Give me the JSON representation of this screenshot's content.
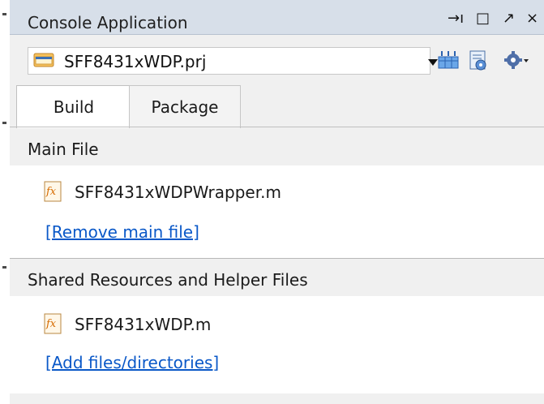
{
  "panel": {
    "title": "Console Application",
    "window_controls": {
      "pin": "→ı",
      "maximize": "□",
      "undock": "↗",
      "close": "×"
    }
  },
  "project": {
    "file_name": "SFF8431xWDP.prj",
    "icons": [
      "project-file-icon",
      "package-icon",
      "build-icon",
      "settings-gear-icon"
    ]
  },
  "tabs": [
    {
      "label": "Build",
      "active": true
    },
    {
      "label": "Package",
      "active": false
    }
  ],
  "main_file": {
    "heading": "Main File",
    "file": "SFF8431xWDPWrapper.m",
    "action_link": "[Remove main file]"
  },
  "shared": {
    "heading": "Shared Resources and Helper Files",
    "file": "SFF8431xWDP.m",
    "action_link": "[Add files/directories]"
  },
  "colors": {
    "link": "#0a58c8",
    "titlebar": "#d7dfe9",
    "background": "#f0f0f0"
  }
}
